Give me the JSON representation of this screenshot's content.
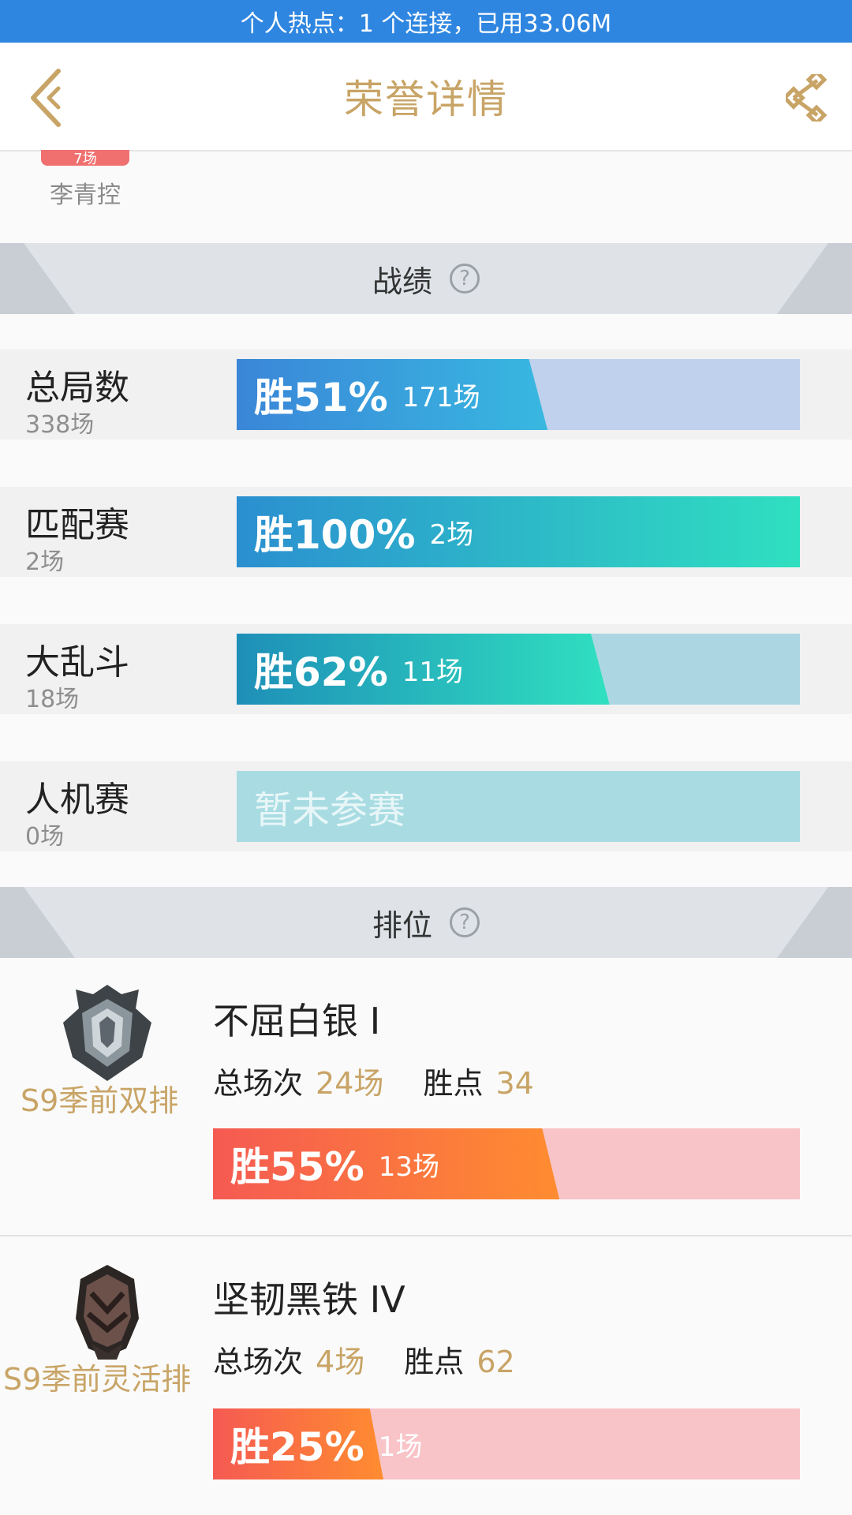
{
  "status_bar": {
    "text": "个人热点：1 个连接，已用33.06M"
  },
  "nav": {
    "title": "荣誉详情",
    "back_icon": "chevron-left-icon",
    "share_icon": "share-icon"
  },
  "hero": {
    "badge": "7场",
    "name": "李青控"
  },
  "sections": {
    "record_title": "战绩",
    "rank_title": "排位",
    "help_icon": "?"
  },
  "stats": [
    {
      "title": "总局数",
      "count": "338场",
      "win_label": "胜51%",
      "games": "171场",
      "win_fraction": 0.51
    },
    {
      "title": "匹配赛",
      "count": "2场",
      "win_label": "胜100%",
      "games": "2场",
      "win_fraction": 1.0
    },
    {
      "title": "大乱斗",
      "count": "18场",
      "win_label": "胜62%",
      "games": "11场",
      "win_fraction": 0.62
    },
    {
      "title": "人机赛",
      "count": "0场",
      "empty_label": "暂未参赛"
    }
  ],
  "ranks": [
    {
      "mode": "S9季前双排",
      "tier": "不屈白银 I",
      "total_label": "总场次",
      "total": "24场",
      "points_label": "胜点",
      "points": "34",
      "win_label": "胜55%",
      "games": "13场",
      "win_fraction": 0.55
    },
    {
      "mode": "S9季前灵活排",
      "tier": "坚韧黑铁 IV",
      "total_label": "总场次",
      "total": "4场",
      "points_label": "胜点",
      "points": "62",
      "win_label": "胜25%",
      "games": "1场",
      "win_fraction": 0.25
    }
  ],
  "colors": {
    "accent_gold": "#c8a466",
    "status_blue": "#2f86e0",
    "rank_bar_bg": "#f8c4c8"
  }
}
